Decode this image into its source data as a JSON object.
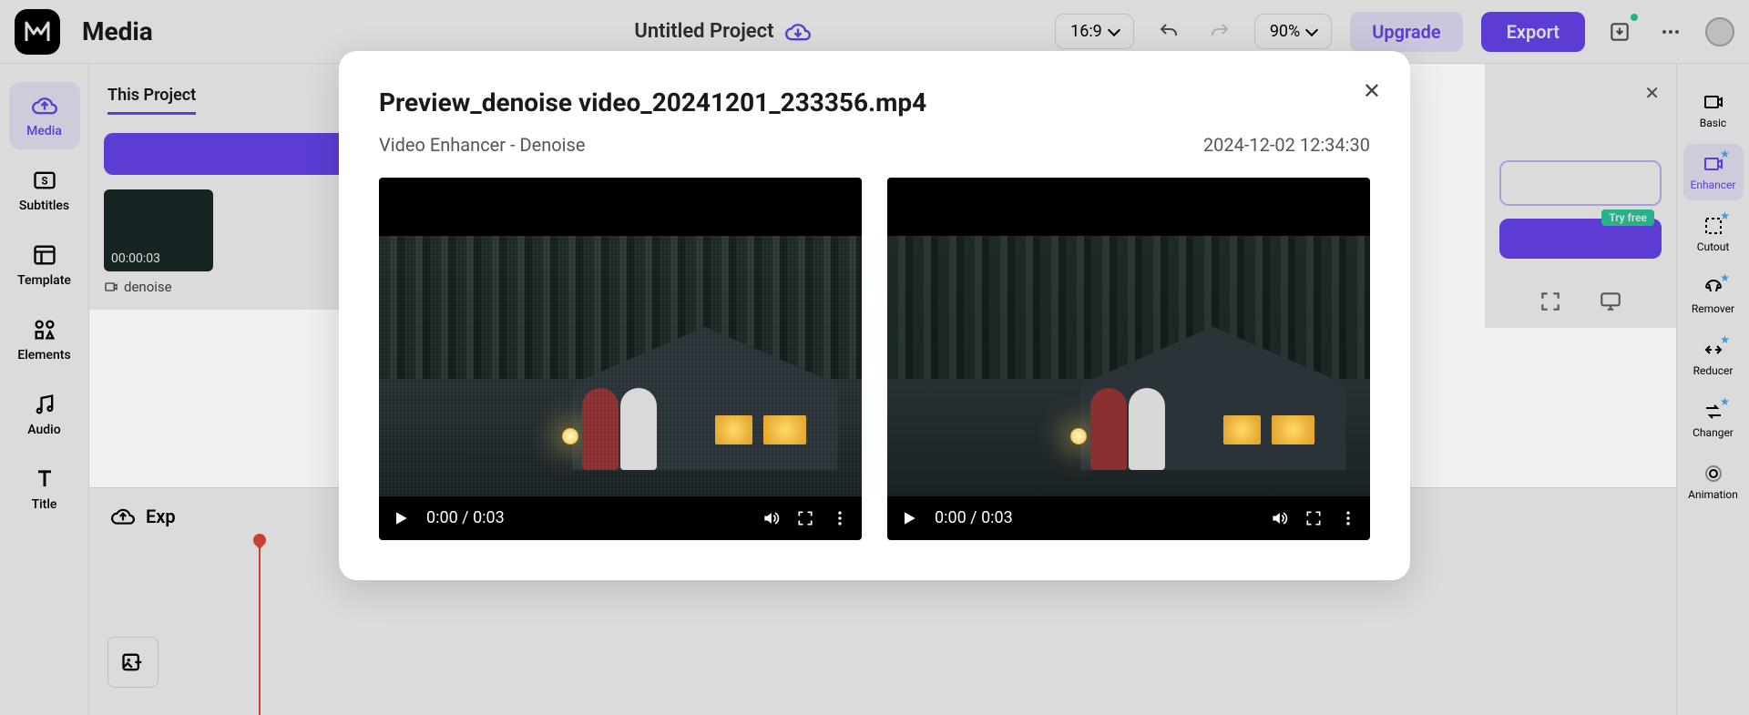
{
  "header": {
    "section_title": "Media",
    "project_name": "Untitled Project",
    "aspect_ratio": "16:9",
    "zoom": "90%",
    "upgrade_label": "Upgrade",
    "export_label": "Export"
  },
  "left_sidebar": [
    {
      "label": "Media",
      "active": true
    },
    {
      "label": "Subtitles"
    },
    {
      "label": "Template"
    },
    {
      "label": "Elements"
    },
    {
      "label": "Audio"
    },
    {
      "label": "Title"
    }
  ],
  "media_panel": {
    "tab_active": "This Project",
    "thumb_time": "00:00:03",
    "thumb_name": "denoise"
  },
  "timeline": {
    "export_label": "Exp"
  },
  "right_sidebar": [
    {
      "label": "Basic"
    },
    {
      "label": "Enhancer",
      "active": true
    },
    {
      "label": "Cutout"
    },
    {
      "label": "Remover"
    },
    {
      "label": "Reducer"
    },
    {
      "label": "Changer"
    },
    {
      "label": "Animation"
    }
  ],
  "inspector": {
    "try_free": "Try free"
  },
  "modal": {
    "title": "Preview_denoise video_20241201_233356.mp4",
    "subtitle": "Video Enhancer - Denoise",
    "timestamp": "2024-12-02 12:34:30",
    "video_time_left": "0:00 / 0:03",
    "video_time_right": "0:00 / 0:03"
  }
}
